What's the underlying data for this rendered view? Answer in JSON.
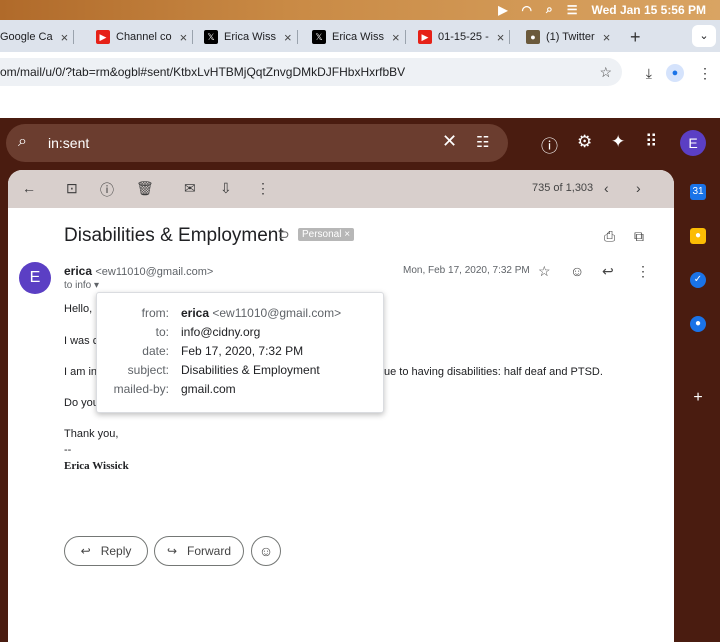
{
  "system": {
    "datetime": "Wed Jan 15  5:56 PM",
    "icons": [
      "play-icon",
      "wifi-icon",
      "search-icon",
      "control-center-icon"
    ]
  },
  "browser": {
    "tabs": [
      {
        "label": "Google Ca",
        "favicon": "google-calendar"
      },
      {
        "label": "Channel co",
        "favicon": "youtube"
      },
      {
        "label": "Erica Wiss",
        "favicon": "x"
      },
      {
        "label": "Erica Wiss",
        "favicon": "x"
      },
      {
        "label": "01-15-25 -",
        "favicon": "youtube"
      },
      {
        "label": "(1) Twitter",
        "favicon": "twitter"
      }
    ],
    "url": "om/mail/u/0/?tab=rm&ogbl#sent/KtbxLvHTBMjQqtZnvgDMkDJFHbxHxrfbBV"
  },
  "gmail": {
    "search_value": "in:sent",
    "account_initial": "E",
    "pager": "735 of 1,303",
    "subject": "Disabilities & Employment",
    "label": "Personal",
    "sender_initial": "E",
    "sender_name": "erica",
    "sender_email": "<ew11010@gmail.com>",
    "to_line": "to info",
    "date": "Mon, Feb 17, 2020, 7:32 PM",
    "body_lines": [
      "Hello,",
      "I was c",
      "I am in",
      "ue to having disabilities: half deaf and PTSD.",
      "Do you",
      "Thank you,",
      "--"
    ],
    "signature": "Erica Wissick",
    "reply_label": "Reply",
    "forward_label": "Forward",
    "details": {
      "from_key": "from:",
      "from_name": "erica",
      "from_email": "<ew11010@gmail.com>",
      "to_key": "to:",
      "to_value": "info@cidny.org",
      "date_key": "date:",
      "date_value": "Feb 17, 2020, 7:32 PM",
      "subject_key": "subject:",
      "subject_value": "Disabilities & Employment",
      "mailedby_key": "mailed-by:",
      "mailedby_value": "gmail.com"
    }
  }
}
